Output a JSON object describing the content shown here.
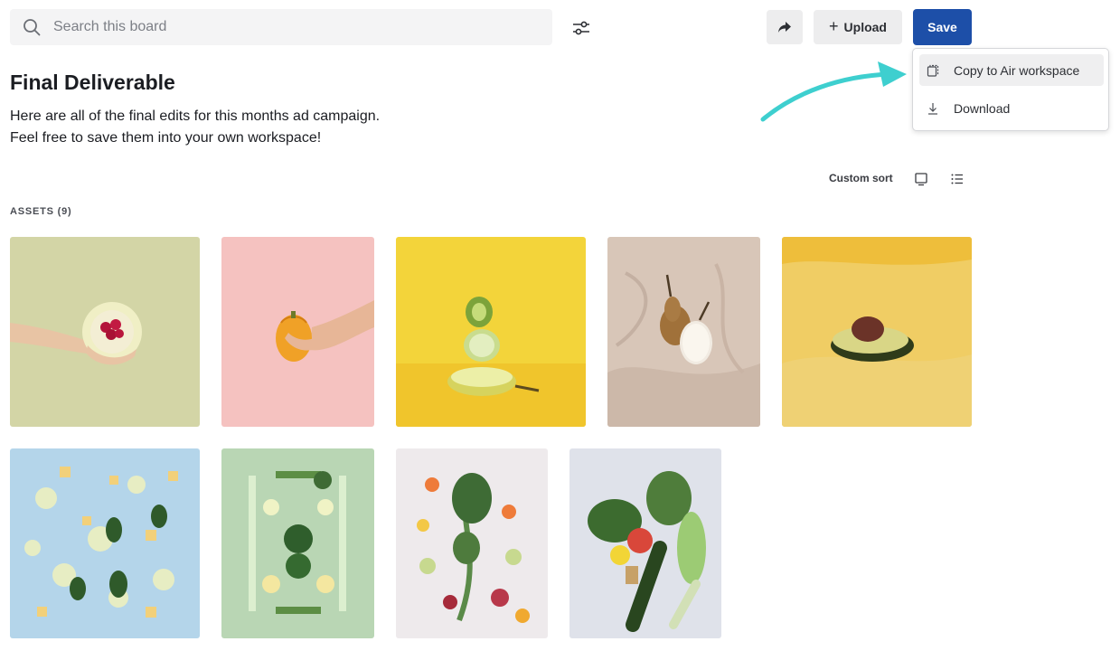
{
  "search": {
    "placeholder": "Search this board"
  },
  "toolbar": {
    "upload_label": "Upload",
    "upload_plus": "+",
    "save_label": "Save"
  },
  "dropdown": {
    "items": [
      {
        "label": "Copy to Air workspace",
        "icon": "copy-icon"
      },
      {
        "label": "Download",
        "icon": "download-icon"
      }
    ]
  },
  "board": {
    "title": "Final Deliverable",
    "description_line1": "Here are all of the final edits for this months ad campaign.",
    "description_line2": "Feel free to save them into your own workspace!"
  },
  "view": {
    "sort_label": "Custom sort"
  },
  "assets": {
    "label": "ASSETS (9)",
    "items": [
      {
        "subject": "hand holding melon with raspberries",
        "bg": "#d3d5a6"
      },
      {
        "subject": "hand holding orange squash",
        "bg": "#f5c2c0"
      },
      {
        "subject": "stacked kiwi lime pear",
        "bg": "#f3d43a"
      },
      {
        "subject": "pears on beige fabric",
        "bg": "#d8c6b8"
      },
      {
        "subject": "avocado half on yellow fabric",
        "bg": "#f0cd64"
      },
      {
        "subject": "lime slices and ginger on blue",
        "bg": "#b4d5ea"
      },
      {
        "subject": "green vegetables flat lay",
        "bg": "#b9d6b4"
      },
      {
        "subject": "kale and sliced vegetables",
        "bg": "#eeeaec"
      },
      {
        "subject": "vegetable bunch with cucumber and apple",
        "bg": "#dfe2ea"
      }
    ]
  },
  "colors": {
    "accent": "#1d4fa8",
    "arrow": "#3ecfcf"
  }
}
